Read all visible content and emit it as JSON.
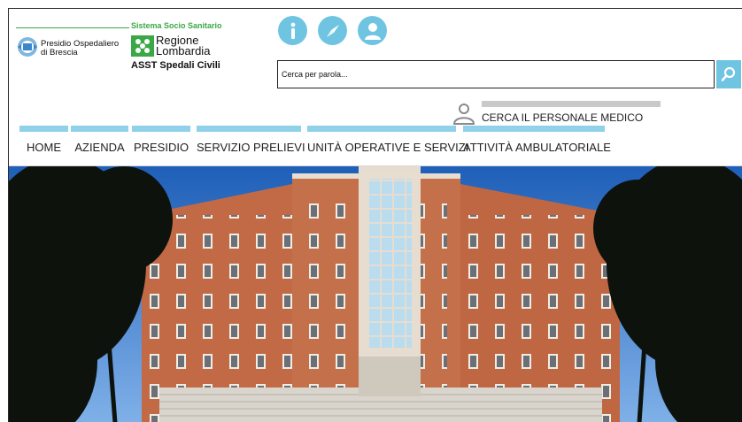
{
  "header": {
    "sistema_label": "Sistema Socio Sanitario",
    "presidio_name": "Presidio Ospedaliero\ndi Brescia",
    "regione_name": "Regione\nLombardia",
    "asst_name": "ASST Spedali Civili"
  },
  "top_icons": [
    {
      "name": "info-icon",
      "glyph": "i"
    },
    {
      "name": "compass-icon"
    },
    {
      "name": "user-icon"
    }
  ],
  "search": {
    "placeholder": "Cerca per parola..."
  },
  "personnel": {
    "label": "CERCA IL PERSONALE MEDICO"
  },
  "nav": {
    "items": [
      {
        "label": "HOME"
      },
      {
        "label": "AZIENDA"
      },
      {
        "label": "PRESIDIO"
      },
      {
        "label": "SERVIZIO PRELIEVI"
      },
      {
        "label": "UNITÀ OPERATIVE E SERVIZI"
      },
      {
        "label": "ATTIVITÀ AMBULATORIALE"
      }
    ]
  },
  "colors": {
    "accent": "#6fc4e2",
    "nav_accent": "#8fd0ea",
    "lombardia_green": "#3aa845",
    "sky": "#2f72c9",
    "brick": "#c06a45"
  }
}
